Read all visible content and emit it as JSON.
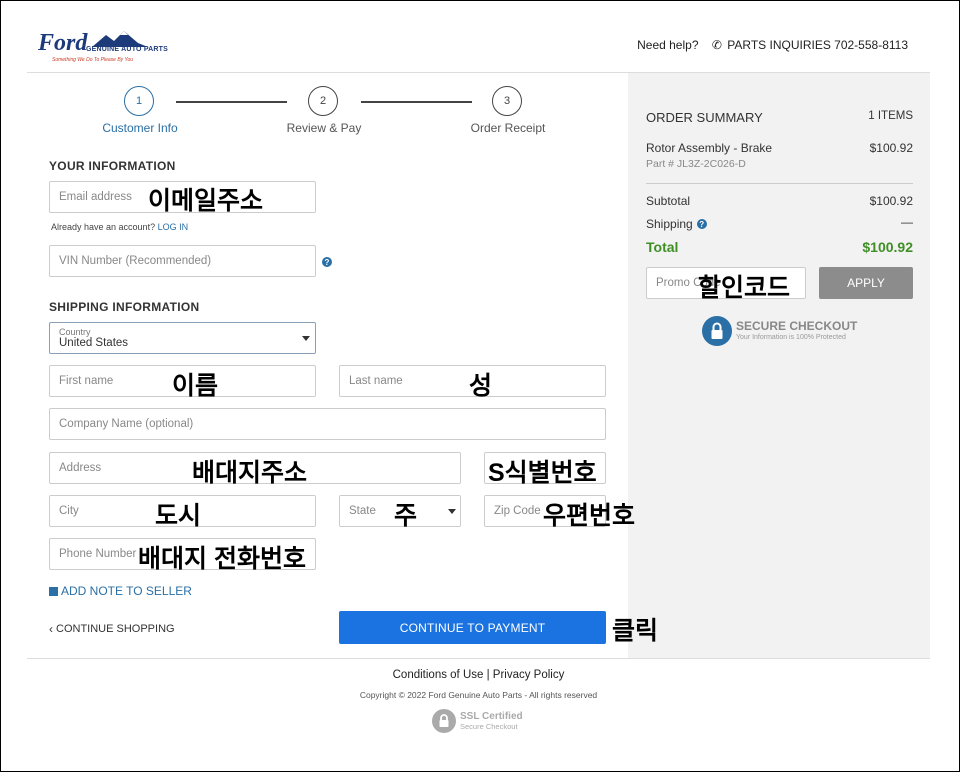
{
  "brand": {
    "logo_text": "Ford",
    "logo_sub": "GENUINE AUTO PARTS",
    "logo_tagline": "Something We Do To Please By You"
  },
  "header": {
    "need_help": "Need help?",
    "phone_label": "PARTS INQUIRIES 702-558-8113"
  },
  "steps": [
    {
      "num": "1",
      "label": "Customer Info"
    },
    {
      "num": "2",
      "label": "Review & Pay"
    },
    {
      "num": "3",
      "label": "Order Receipt"
    }
  ],
  "your_info": {
    "title": "YOUR INFORMATION",
    "email_placeholder": "Email address",
    "email_note": "이메일주소",
    "account_prompt": "Already have an account?",
    "login_link": "LOG IN",
    "vin_placeholder": "VIN Number (Recommended)"
  },
  "shipping": {
    "title": "SHIPPING INFORMATION",
    "country_label": "Country",
    "country_value": "United States",
    "first_name": "First name",
    "first_name_note": "이름",
    "last_name": "Last name",
    "last_name_note": "성",
    "company": "Company Name (optional)",
    "address": "Address",
    "address_note": "배대지주소",
    "address2_note": "S식별번호",
    "city": "City",
    "city_note": "도시",
    "state": "State",
    "state_note": "주",
    "zip": "Zip Code",
    "zip_note": "우편번호",
    "phone": "Phone Number",
    "phone_note": "배대지 전화번호",
    "add_note": "ADD NOTE TO SELLER"
  },
  "actions": {
    "continue_shopping": "CONTINUE SHOPPING",
    "continue_payment": "CONTINUE TO PAYMENT",
    "click_note": "클릭"
  },
  "summary": {
    "title": "ORDER SUMMARY",
    "items_count": "1 ITEMS",
    "product_name": "Rotor Assembly - Brake",
    "product_price": "$100.92",
    "part_number": "Part # JL3Z-2C026-D",
    "subtotal_label": "Subtotal",
    "subtotal_value": "$100.92",
    "shipping_label": "Shipping",
    "shipping_value": "—",
    "total_label": "Total",
    "total_value": "$100.92",
    "promo_placeholder": "Promo Code",
    "promo_note": "할인코드",
    "apply": "APPLY",
    "secure_title": "SECURE CHECKOUT",
    "secure_sub": "Your Information is 100% Protected"
  },
  "footer": {
    "links": "Conditions of Use | Privacy Policy",
    "copyright": "Copyright © 2022 Ford Genuine Auto Parts - All rights reserved",
    "ssl_title": "SSL Certified",
    "ssl_sub": "Secure Checkout"
  },
  "colors": {
    "accent": "#2a6fa5",
    "primary_button": "#1a73e0",
    "total_green": "#3f8f25",
    "apply_grey": "#8c8c8c"
  }
}
